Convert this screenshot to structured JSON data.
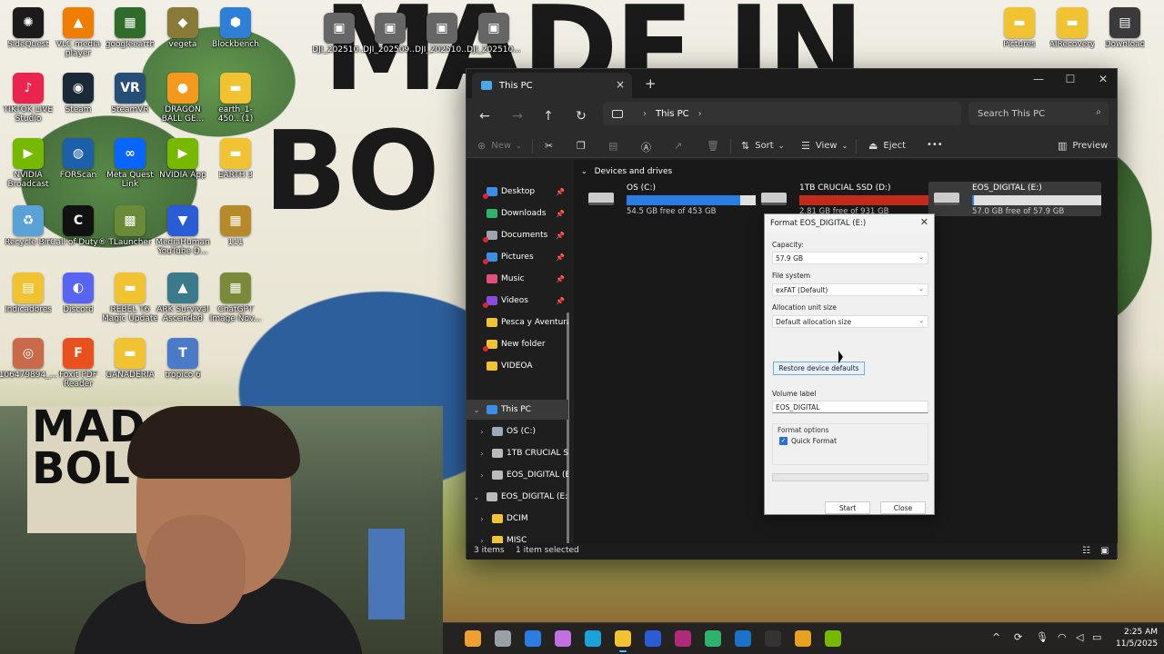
{
  "desktop": {
    "icons": [
      {
        "label": "SideQuest",
        "glyph": "✺",
        "color": "#1b1b1b"
      },
      {
        "label": "VLC media player",
        "glyph": "▲",
        "color": "#ef7d00"
      },
      {
        "label": "googleearth",
        "glyph": "▦",
        "color": "#2f6b2a"
      },
      {
        "label": "vegeta",
        "glyph": "◆",
        "color": "#8a7a3a"
      },
      {
        "label": "Blockbench",
        "glyph": "⬢",
        "color": "#2f7fd6"
      },
      {
        "label": "TIKTOK LIVE Studio",
        "glyph": "♪",
        "color": "#e8244f"
      },
      {
        "label": "Steam",
        "glyph": "◉",
        "color": "#1b2838"
      },
      {
        "label": "SteamVR",
        "glyph": "VR",
        "color": "#274e77"
      },
      {
        "label": "DRAGON BALL GE...",
        "glyph": "●",
        "color": "#f39a1e"
      },
      {
        "label": "earth_1-450...(1)",
        "glyph": "▬",
        "color": "#f1c232"
      },
      {
        "label": "NVIDIA Broadcast",
        "glyph": "▶",
        "color": "#76b900"
      },
      {
        "label": "FORScan",
        "glyph": "◍",
        "color": "#1d5fa8"
      },
      {
        "label": "Meta Quest Link",
        "glyph": "∞",
        "color": "#0866ff"
      },
      {
        "label": "NVIDIA App",
        "glyph": "▶",
        "color": "#76b900"
      },
      {
        "label": "EARTH 3",
        "glyph": "▬",
        "color": "#f1c232"
      },
      {
        "label": "Recycle Bin",
        "glyph": "♻",
        "color": "#5aa2d6"
      },
      {
        "label": "Call of Duty®",
        "glyph": "C",
        "color": "#111111"
      },
      {
        "label": "TLauncher",
        "glyph": "▩",
        "color": "#6a8a3a"
      },
      {
        "label": "MediaHuman YouTube D...",
        "glyph": "▼",
        "color": "#2a5cd6"
      },
      {
        "label": "111",
        "glyph": "▦",
        "color": "#b68a2a"
      },
      {
        "label": "Indicadores",
        "glyph": "▤",
        "color": "#f1c232"
      },
      {
        "label": "Discord",
        "glyph": "◐",
        "color": "#5865f2"
      },
      {
        "label": "REBEL T6 Magic Update",
        "glyph": "▬",
        "color": "#f1c232"
      },
      {
        "label": "ARK Survival Ascended",
        "glyph": "▲",
        "color": "#3a7a8a"
      },
      {
        "label": "ChatGPT Image Nov...",
        "glyph": "▦",
        "color": "#7a8a3a"
      },
      {
        "label": "106479894_...",
        "glyph": "◎",
        "color": "#c96a4a"
      },
      {
        "label": "Foxit PDF Reader",
        "glyph": "F",
        "color": "#e8501e"
      },
      {
        "label": "GANADERIA",
        "glyph": "▬",
        "color": "#f1c232"
      },
      {
        "label": "tropico 6",
        "glyph": "T",
        "color": "#4a7ac8"
      },
      {
        "label": "DJI_202510...",
        "glyph": "▣",
        "color": "#666666"
      },
      {
        "label": "DJI_202509...",
        "glyph": "▣",
        "color": "#666666"
      },
      {
        "label": "DJI_202510...",
        "glyph": "▣",
        "color": "#666666"
      },
      {
        "label": "DJI_202510...",
        "glyph": "▣",
        "color": "#666666"
      },
      {
        "label": "Pictures",
        "glyph": "▬",
        "color": "#f1c232"
      },
      {
        "label": "AIRecovery",
        "glyph": "▬",
        "color": "#f1c232"
      },
      {
        "label": "Download",
        "glyph": "▤",
        "color": "#3a3a3a"
      }
    ],
    "wallpaper_text": [
      "MADE IN",
      "BO"
    ],
    "webcam_poster_text": [
      "MAD",
      "BOL"
    ]
  },
  "explorer": {
    "tab_title": "This PC",
    "new_tab": "+",
    "close_tab": "×",
    "window_controls": {
      "minimize": "—",
      "maximize": "☐",
      "close": "✕"
    },
    "nav": {
      "back": "←",
      "forward": "→",
      "up": "↑",
      "refresh": "↻"
    },
    "address": {
      "segment": "This PC",
      "sep": "›"
    },
    "search_placeholder": "Search This PC",
    "toolbar": {
      "new": "New",
      "sort": "Sort",
      "view": "View",
      "eject": "Eject",
      "more": "•••",
      "preview": "Preview"
    },
    "nav_items": [
      {
        "label": "Desktop",
        "color": "#3a8ee6",
        "pinned": true
      },
      {
        "label": "Downloads",
        "color": "#2db36b",
        "pinned": true
      },
      {
        "label": "Documents",
        "color": "#9aa4b0",
        "pinned": true
      },
      {
        "label": "Pictures",
        "color": "#3a8ee6",
        "pinned": true
      },
      {
        "label": "Music",
        "color": "#e0507a",
        "pinned": true
      },
      {
        "label": "Videos",
        "color": "#8a4ae0",
        "pinned": true
      },
      {
        "label": "Pesca y Aventura",
        "color": "#f1c232",
        "pinned": false
      },
      {
        "label": "New folder",
        "color": "#f1c232",
        "pinned": false
      },
      {
        "label": "VIDEOA",
        "color": "#f1c232",
        "pinned": false
      }
    ],
    "tree": [
      {
        "label": "This PC",
        "expander": "⌄",
        "color": "#3a8ee6"
      },
      {
        "label": "OS (C:)",
        "expander": "›",
        "color": "#9ab"
      },
      {
        "label": "1TB CRUCIAL S",
        "expander": "›",
        "color": "#bbb"
      },
      {
        "label": "EOS_DIGITAL (E",
        "expander": "›",
        "color": "#bbb"
      },
      {
        "label": "EOS_DIGITAL (E:)",
        "expander": "⌄",
        "color": "#bbb"
      },
      {
        "label": "DCIM",
        "expander": "›",
        "color": "#f1c232"
      },
      {
        "label": "MISC",
        "expander": "›",
        "color": "#f1c232"
      }
    ],
    "group_heading": "Devices and drives",
    "drives": [
      {
        "name": "OS (C:)",
        "free": "54.5 GB free of 453 GB",
        "used_fraction": 0.88,
        "bar_color": "#2a7de1"
      },
      {
        "name": "1TB CRUCIAL SSD (D:)",
        "free": "2.81 GB free of 931 GB",
        "used_fraction": 0.997,
        "bar_color": "#c42b1c"
      },
      {
        "name": "EOS_DIGITAL (E:)",
        "free": "57.0 GB free of 57.9 GB",
        "used_fraction": 0.016,
        "bar_color": "#2a7de1"
      }
    ],
    "status": {
      "items": "3 items",
      "selected": "1 item selected"
    }
  },
  "format_dialog": {
    "title": "Format EOS_DIGITAL (E:)",
    "close": "✕",
    "capacity_label": "Capacity:",
    "capacity_value": "57.9 GB",
    "filesystem_label": "File system",
    "filesystem_value": "exFAT (Default)",
    "allocation_label": "Allocation unit size",
    "allocation_value": "Default allocation size",
    "restore_button": "Restore device defaults",
    "volume_label": "Volume label",
    "volume_value": "EOS_DIGITAL",
    "format_options_label": "Format options",
    "quick_format_label": "Quick Format",
    "quick_format_checked": true,
    "progress": 0,
    "start_button": "Start",
    "close_button": "Close"
  },
  "taskbar": {
    "apps": [
      {
        "name": "weather",
        "color": "#f0a030"
      },
      {
        "name": "task-view",
        "color": "#9aa0a8"
      },
      {
        "name": "store",
        "color": "#2a7de1"
      },
      {
        "name": "copilot",
        "color": "#c070e0"
      },
      {
        "name": "edge",
        "color": "#1ca2d8"
      },
      {
        "name": "file-explorer",
        "color": "#f1c232"
      },
      {
        "name": "docs",
        "color": "#2a5cd6"
      },
      {
        "name": "winrar",
        "color": "#b02a7a"
      },
      {
        "name": "stocks",
        "color": "#2db36b"
      },
      {
        "name": "outlook",
        "color": "#1a73c8"
      },
      {
        "name": "obs",
        "color": "#333333"
      },
      {
        "name": "chrome",
        "color": "#e8a020"
      },
      {
        "name": "nvidia",
        "color": "#76b900"
      }
    ],
    "tray": {
      "chevron": "^",
      "wifi": "◠",
      "volume": "◁",
      "battery": "▭"
    },
    "time": "2:25 AM",
    "date": "11/5/2025"
  }
}
